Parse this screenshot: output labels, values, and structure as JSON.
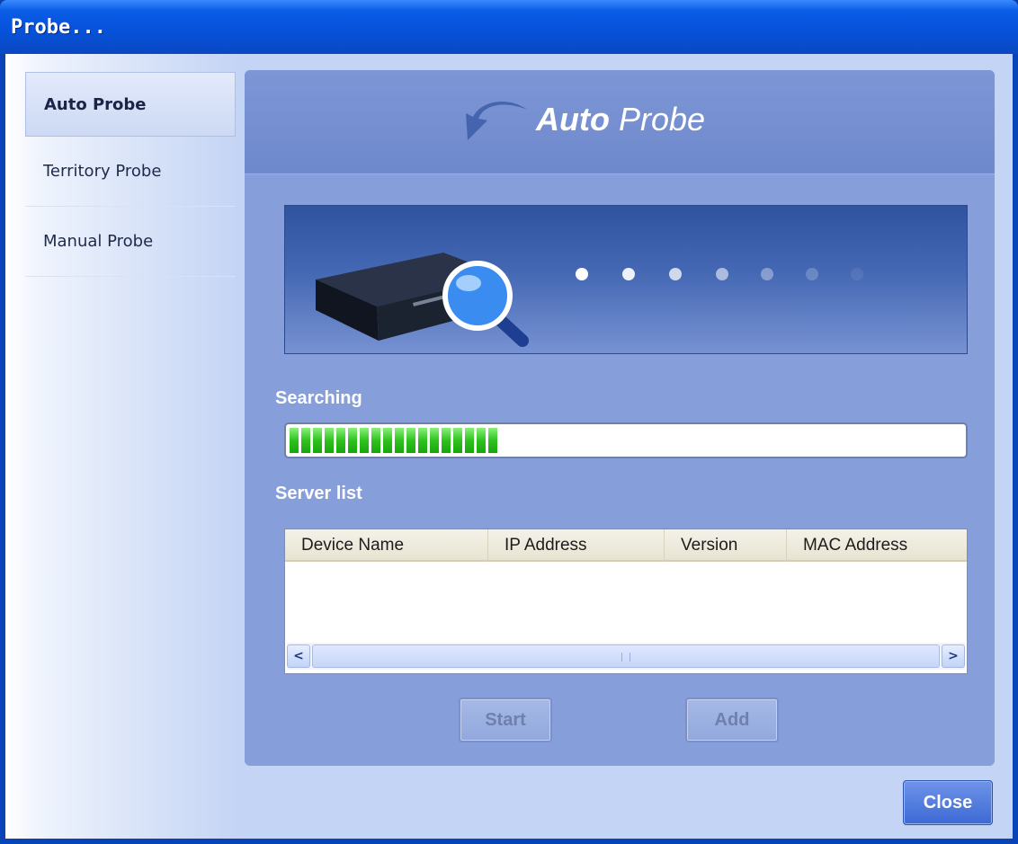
{
  "window": {
    "title": "Probe..."
  },
  "sidebar": {
    "items": [
      {
        "label": "Auto Probe",
        "active": true
      },
      {
        "label": "Territory Probe",
        "active": false
      },
      {
        "label": "Manual Probe",
        "active": false
      }
    ]
  },
  "header": {
    "title_bold": "Auto",
    "title_rest": " Probe",
    "icon": "back-arrow-icon"
  },
  "banner": {
    "icons": [
      "network-switch-icon",
      "magnifier-icon"
    ]
  },
  "progress": {
    "label": "Searching",
    "fraction": 0.32
  },
  "server_list": {
    "label": "Server list",
    "columns": [
      "Device Name",
      "IP Address",
      "Version",
      "MAC Address"
    ],
    "rows": []
  },
  "buttons": {
    "start": "Start",
    "add": "Add",
    "close": "Close"
  },
  "colors": {
    "titlebar": "#0651d8",
    "panel": "#869ed9",
    "progress": "#2fc21f",
    "close_button": "#3c69d4"
  }
}
